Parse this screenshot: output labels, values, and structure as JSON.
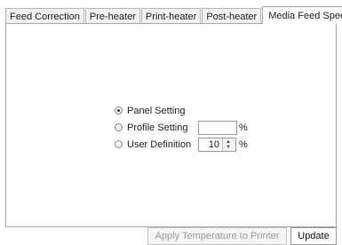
{
  "tabs": [
    {
      "label": "Feed Correction"
    },
    {
      "label": "Pre-heater"
    },
    {
      "label": "Print-heater"
    },
    {
      "label": "Post-heater"
    },
    {
      "label": "Media Feed Speed",
      "active": true
    }
  ],
  "options": {
    "panel_setting": {
      "label": "Panel Setting",
      "checked": true
    },
    "profile_setting": {
      "label": "Profile Setting",
      "value": "",
      "unit": "%",
      "checked": false
    },
    "user_definition": {
      "label": "User Definition",
      "value": "10",
      "unit": "%",
      "checked": false
    }
  },
  "buttons": {
    "apply_label": "Apply Temperature to Printer",
    "update_label": "Update"
  }
}
